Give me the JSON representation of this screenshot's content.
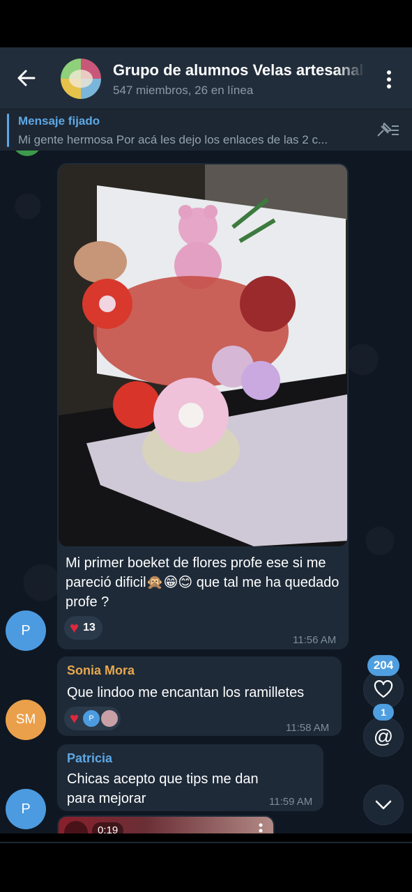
{
  "header": {
    "title": "Grupo de alumnos Velas artesanales",
    "subtitle": "547 miembros, 26 en línea"
  },
  "pinned": {
    "label": "Mensaje fijado",
    "text": "Mi gente hermosa Por acá les dejo los enlaces de las 2 c..."
  },
  "messages": [
    {
      "avatar": "P",
      "text": "Mi primer boeket de flores profe  ese si me pareció dificil🙊😁😊 que tal me ha quedado profe ?",
      "reaction": {
        "emoji": "❤️",
        "count": "13"
      },
      "time": "11:56 AM"
    },
    {
      "avatar": "SM",
      "sender": "Sonia Mora",
      "sender_color": "#e9a84e",
      "text": "Que lindoo me encantan los ramilletes",
      "reaction": {
        "emoji": "❤️",
        "user": "P"
      },
      "time": "11:58 AM"
    },
    {
      "avatar": "P",
      "sender": "Patricia",
      "sender_color": "#5ea8e6",
      "text": "Chicas acepto que tips me dan para mejorar",
      "time": "11:59 AM"
    },
    {
      "video_duration": "0:19"
    }
  ],
  "fabs": {
    "reactions_count": "204",
    "mentions_count": "1"
  },
  "colors": {
    "header_bg": "#212d3b",
    "bubble_bg": "#1e2a38",
    "accent": "#5ea8e6",
    "heart": "#e0283c"
  }
}
